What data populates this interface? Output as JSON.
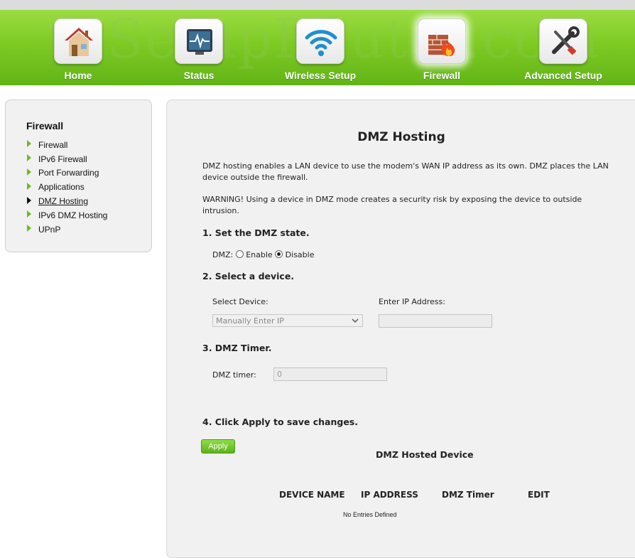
{
  "nav": {
    "watermark": "SetupRouter.com",
    "items": [
      {
        "label": "Home",
        "icon": "home-icon"
      },
      {
        "label": "Status",
        "icon": "status-monitor-icon"
      },
      {
        "label": "Wireless Setup",
        "icon": "wifi-icon"
      },
      {
        "label": "Firewall",
        "icon": "firewall-icon"
      },
      {
        "label": "Advanced Setup",
        "icon": "tools-icon"
      }
    ],
    "active": "Firewall"
  },
  "sidebar": {
    "title": "Firewall",
    "items": [
      {
        "label": "Firewall"
      },
      {
        "label": "IPv6 Firewall"
      },
      {
        "label": "Port Forwarding"
      },
      {
        "label": "Applications"
      },
      {
        "label": "DMZ Hosting"
      },
      {
        "label": "IPv6 DMZ Hosting"
      },
      {
        "label": "UPnP"
      }
    ],
    "current": "DMZ Hosting"
  },
  "main": {
    "title": "DMZ Hosting",
    "intro": "DMZ hosting enables a LAN device to use the modem's WAN IP address as its own. DMZ places the LAN device outside the firewall.",
    "warning": "WARNING! Using a device in DMZ mode creates a security risk by exposing the device to outside intrusion.",
    "step1": {
      "heading": "1. Set the DMZ state.",
      "label": "DMZ:",
      "enable_label": "Enable",
      "disable_label": "Disable",
      "selected": "Disable"
    },
    "step2": {
      "heading": "2. Select a device.",
      "select_label": "Select Device:",
      "select_value": "Manually Enter IP",
      "ip_label": "Enter IP Address:",
      "ip_value": ""
    },
    "step3": {
      "heading": "3. DMZ Timer.",
      "timer_label": "DMZ timer:",
      "timer_value": "0"
    },
    "step4": {
      "heading": "4. Click Apply to save changes.",
      "apply_label": "Apply"
    },
    "table": {
      "title": "DMZ Hosted Device",
      "columns": [
        "DEVICE NAME",
        "IP ADDRESS",
        "DMZ Timer",
        "EDIT"
      ],
      "empty_text": "No Entries Defined"
    }
  },
  "colors": {
    "nav_green": "#6cbd21",
    "panel_bg": "#f1f1f1",
    "apply_green": "#6cbf22"
  }
}
